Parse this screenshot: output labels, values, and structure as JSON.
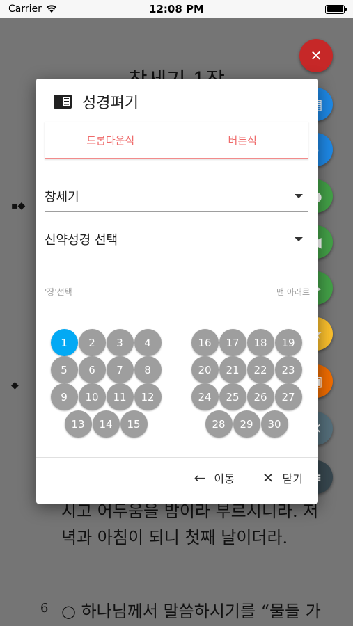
{
  "status_bar": {
    "carrier": "Carrier",
    "time": "12:08 PM"
  },
  "background": {
    "page_title": "창세기 1장",
    "verse_5_tail": "시고 어두움을 밤이라 부르시니라. 저녁과 아침이 되니 첫째 날이더라.",
    "verse_6_num": "6",
    "verse_6_text": "○ 하나님께서 말씀하시기를 “물들 가운데 창공이 있으라. 창공은"
  },
  "fab": [
    {
      "icon": "close-icon",
      "color": "#d32f2f"
    },
    {
      "icon": "book-icon",
      "color": "#1e88e5"
    },
    {
      "icon": "search-icon",
      "color": "#1e88e5"
    },
    {
      "icon": "location-icon",
      "color": "#43a047"
    },
    {
      "icon": "prev-icon",
      "color": "#43a047"
    },
    {
      "icon": "next-icon",
      "color": "#43a047"
    },
    {
      "icon": "bookmark-icon",
      "color": "#fbc02d"
    },
    {
      "icon": "note-icon",
      "color": "#ef6c00"
    },
    {
      "icon": "close-icon",
      "color": "#546e7a"
    },
    {
      "icon": "menu-icon",
      "color": "#37474f"
    }
  ],
  "dialog": {
    "title": "성경펴기",
    "tabs": [
      {
        "label": "드롭다운식"
      },
      {
        "label": "버튼식"
      }
    ],
    "book_select": "창세기",
    "testament_select": "신약성경 선택",
    "chapter_hint": "'장'선택",
    "scroll_bottom": "맨 아래로",
    "selected_chapter": "1",
    "chapters_left": [
      "1",
      "2",
      "3",
      "4",
      "5",
      "6",
      "7",
      "8",
      "9",
      "10",
      "11",
      "12",
      "13",
      "14",
      "15"
    ],
    "chapters_right": [
      "16",
      "17",
      "18",
      "19",
      "20",
      "21",
      "22",
      "23",
      "24",
      "25",
      "26",
      "27",
      "28",
      "29",
      "30"
    ],
    "actions": {
      "move": "이동",
      "close": "닫기"
    }
  },
  "colors": {
    "accent": "#ef6b6b",
    "selected": "#03a9f4",
    "chapter_bg": "#9e9e9e"
  }
}
